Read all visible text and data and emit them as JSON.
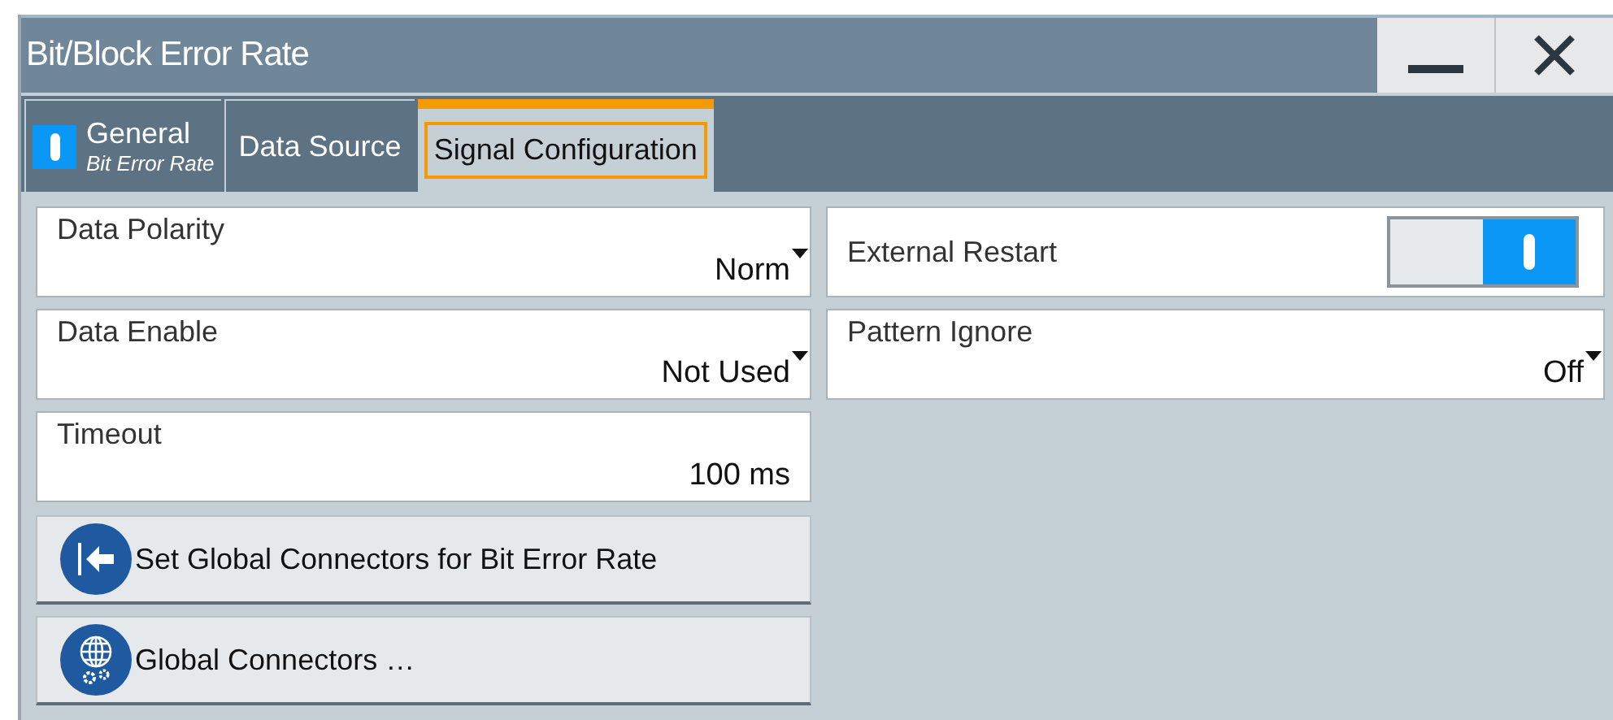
{
  "window": {
    "title": "Bit/Block Error Rate"
  },
  "tabs": [
    {
      "label": "General",
      "sublabel": "Bit Error Rate",
      "on": true,
      "selected": false
    },
    {
      "label": "Data Source",
      "selected": false
    },
    {
      "label": "Signal Configuration",
      "selected": true
    }
  ],
  "left_fields": [
    {
      "kind": "dropdown",
      "label": "Data Polarity",
      "value": "Norm"
    },
    {
      "kind": "dropdown",
      "label": "Data Enable",
      "value": "Not Used"
    },
    {
      "kind": "value",
      "label": "Timeout",
      "value": "100 ms"
    }
  ],
  "right_fields": [
    {
      "kind": "toggle",
      "label": "External Restart",
      "on": true
    },
    {
      "kind": "dropdown",
      "label": "Pattern Ignore",
      "value": "Off"
    }
  ],
  "buttons": [
    {
      "kind": "arrow",
      "label": "Set Global Connectors for Bit Error Rate"
    },
    {
      "kind": "globe",
      "label": "Global Connectors …"
    }
  ]
}
